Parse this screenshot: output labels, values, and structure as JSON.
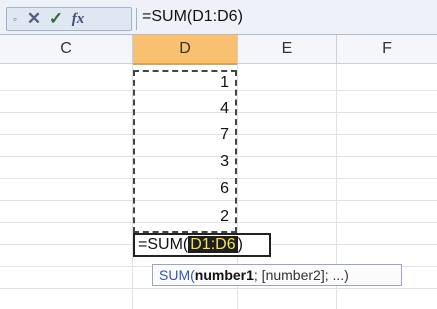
{
  "formula_bar": {
    "icons": [
      "name-box-dropdown-icon",
      "cancel-icon",
      "enter-icon",
      "insert-function-icon"
    ],
    "cancel_glyph": "✕",
    "enter_glyph": "✓",
    "fx_glyph": "fx",
    "value": "=SUM(D1:D6)"
  },
  "columns": [
    {
      "label": "C",
      "selected": false
    },
    {
      "label": "D",
      "selected": true
    },
    {
      "label": "E",
      "selected": false
    },
    {
      "label": "F",
      "selected": false
    }
  ],
  "cells": {
    "column": "D",
    "values": [
      "1",
      "4",
      "7",
      "3",
      "6",
      "2"
    ]
  },
  "editing_cell": {
    "prefix": "=SUM(",
    "reference": "D1:D6",
    "suffix": ")"
  },
  "tooltip": {
    "function": "SUM(",
    "arg_bold": "number1",
    "rest": "; [number2]; ...)"
  },
  "colors": {
    "selected_column_header": "#f8c070",
    "reference_highlight": "#1f1f1f",
    "reference_text": "#f3e15a"
  }
}
